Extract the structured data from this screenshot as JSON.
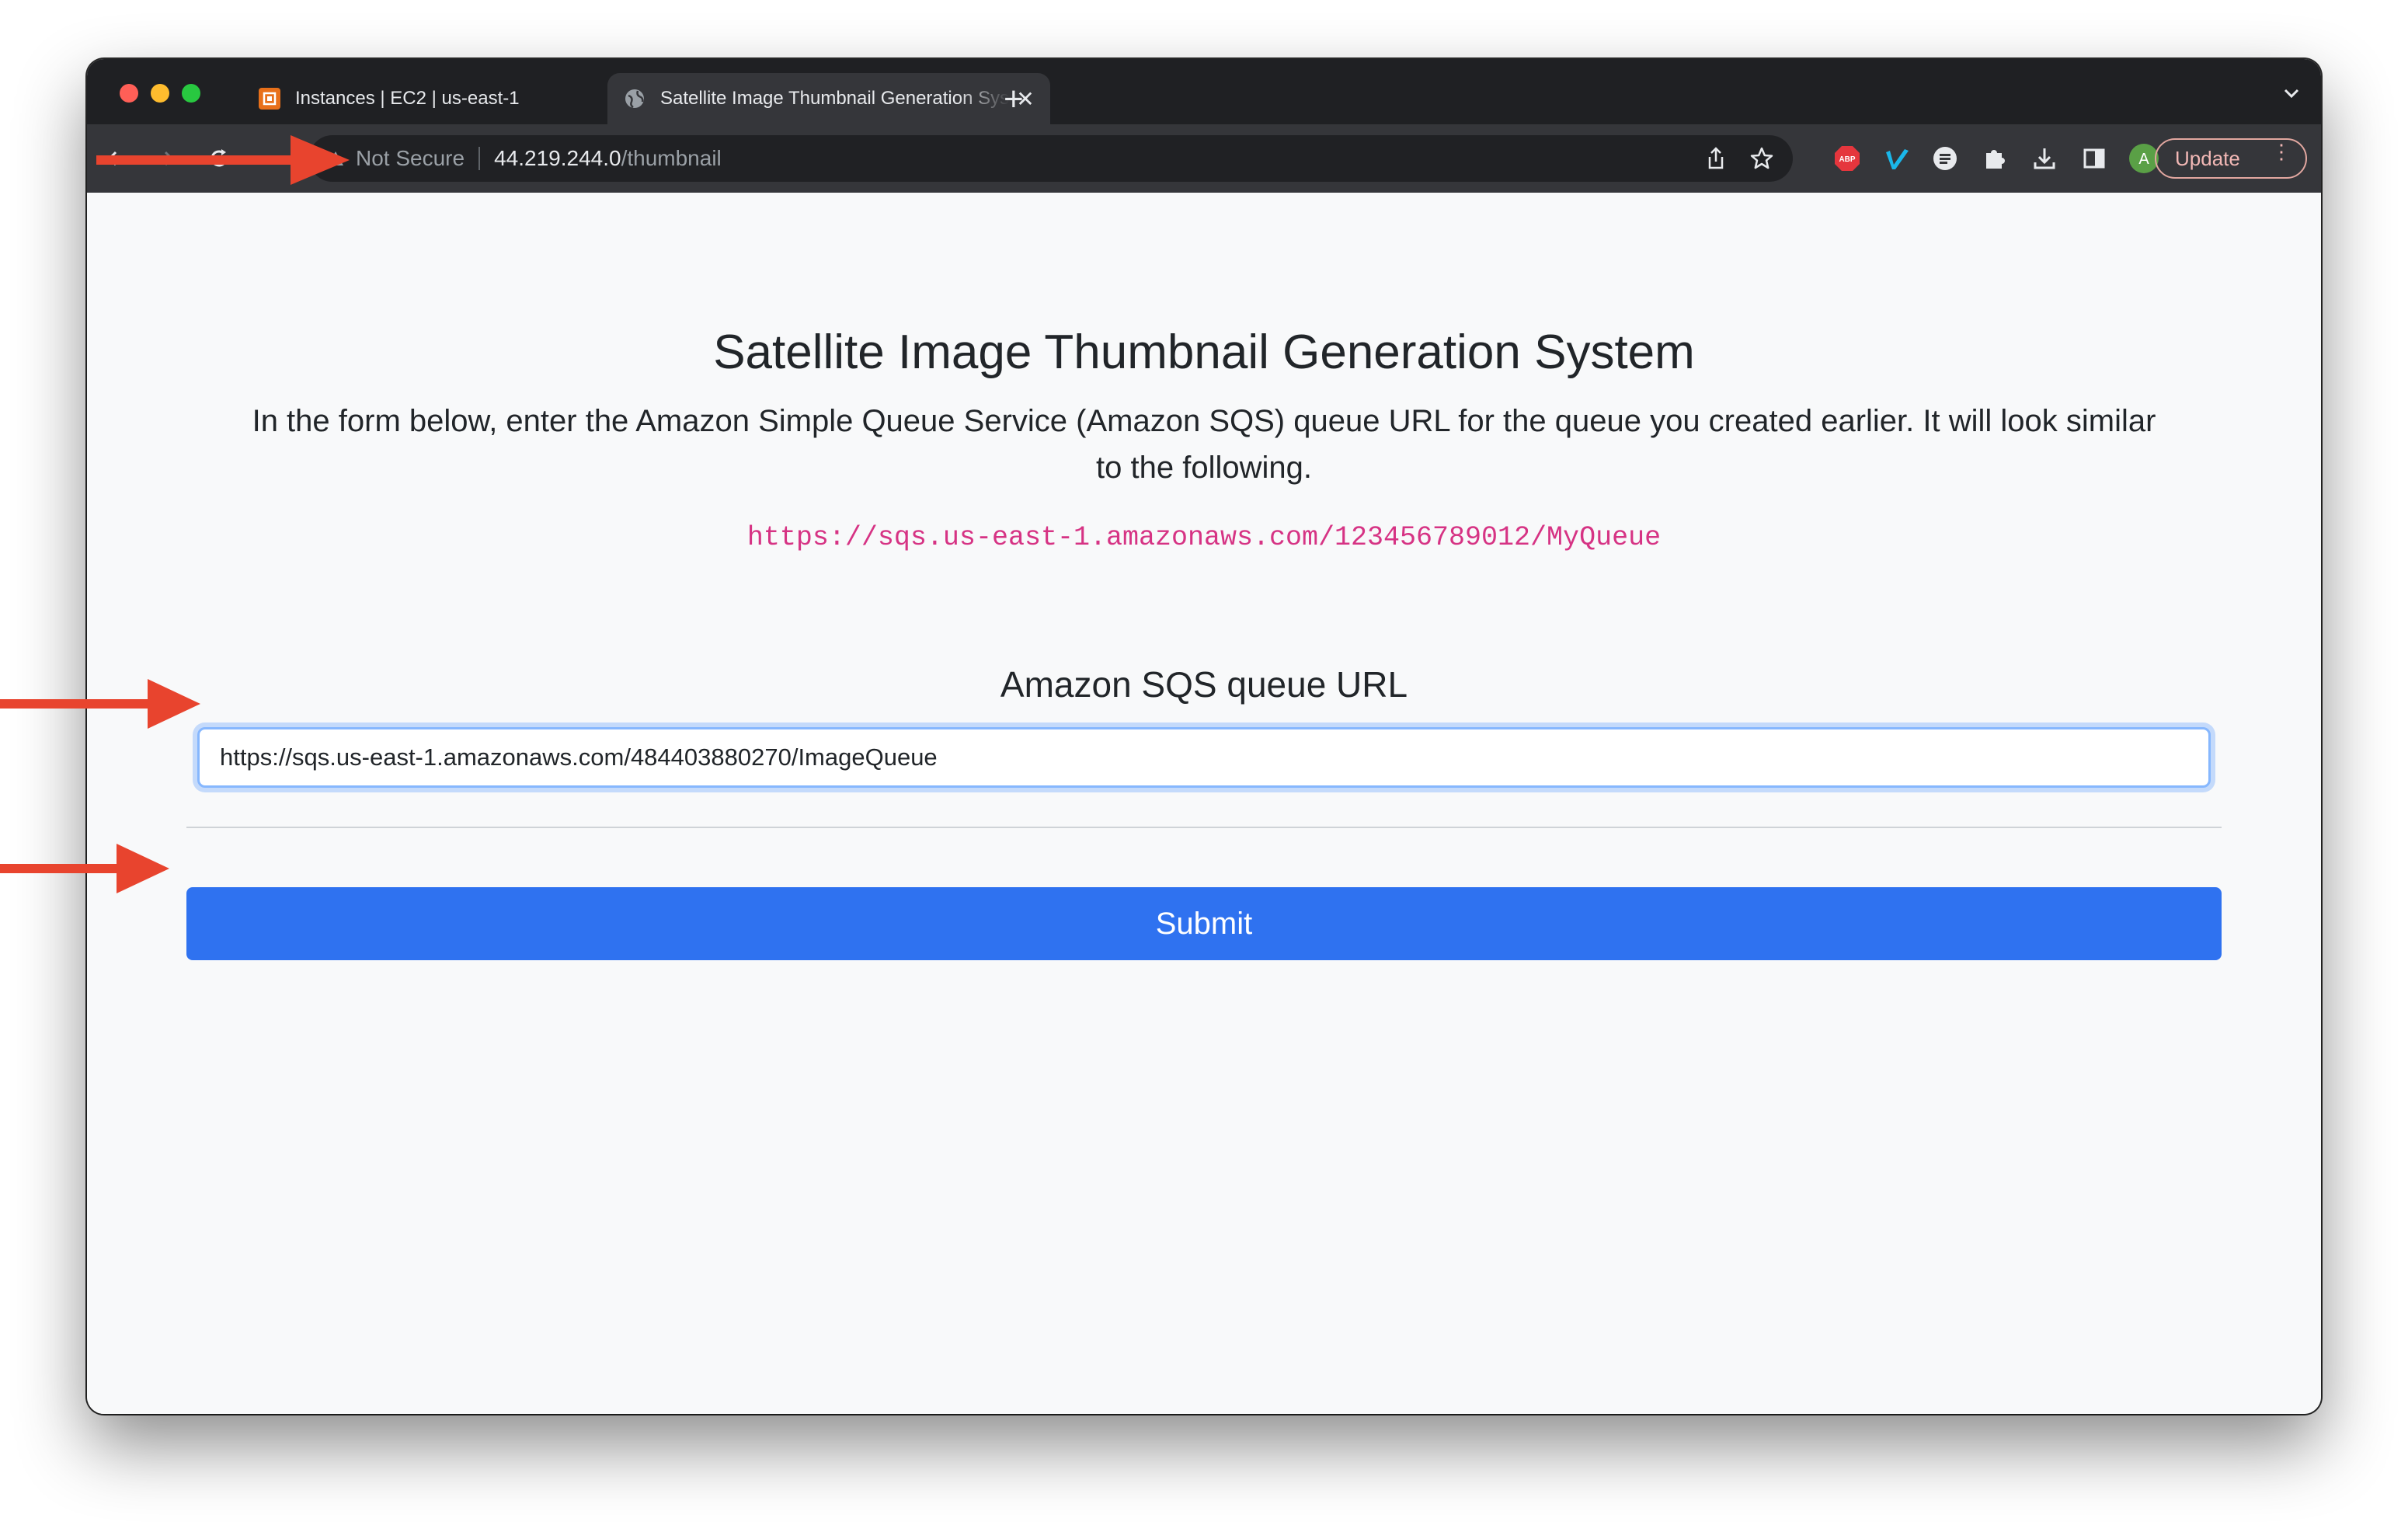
{
  "browser": {
    "tabs": [
      {
        "title": "Instances | EC2 | us-east-1",
        "active": false
      },
      {
        "title": "Satellite Image Thumbnail Generation System",
        "active": true
      }
    ],
    "new_tab": "+",
    "address": {
      "security_label": "Not Secure",
      "host": "44.219.244.0",
      "path": "/thumbnail"
    },
    "profile_initial": "A",
    "update_label": "Update",
    "abp_label": "ABP"
  },
  "page": {
    "heading": "Satellite Image Thumbnail Generation System",
    "lead": "In the form below, enter the Amazon Simple Queue Service (Amazon SQS) queue URL for the queue you created earlier. It will look similar to the following.",
    "example_url": "https://sqs.us-east-1.amazonaws.com/123456789012/MyQueue",
    "field_label": "Amazon SQS queue URL",
    "field_value": "https://sqs.us-east-1.amazonaws.com/484403880270/ImageQueue",
    "submit_label": "Submit"
  },
  "colors": {
    "annotation_arrow": "#e8442e",
    "primary_button": "#2f72f0",
    "code_text": "#d63384"
  }
}
